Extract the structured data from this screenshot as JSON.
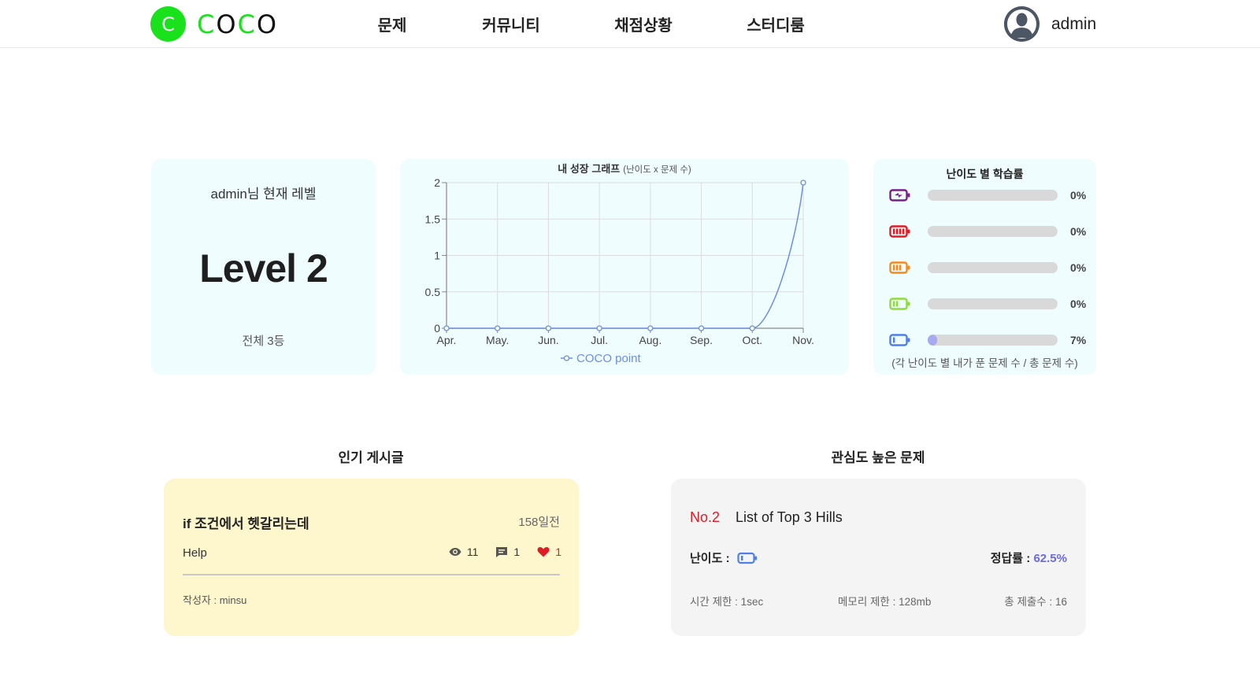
{
  "header": {
    "logo_letter": "C",
    "logo_text": [
      "C",
      "O",
      "C",
      "O"
    ],
    "nav": [
      "문제",
      "커뮤니티",
      "채점상황",
      "스터디룸"
    ],
    "user_name": "admin"
  },
  "level_card": {
    "title": "admin님 현재 레벨",
    "level": "Level 2",
    "rank": "전체 3등"
  },
  "chart_data": {
    "type": "line",
    "title": "내 성장 그래프",
    "subtitle": "(난이도 x 문제 수)",
    "x": [
      "Apr.",
      "May.",
      "Jun.",
      "Jul.",
      "Aug.",
      "Sep.",
      "Oct.",
      "Nov."
    ],
    "series": [
      {
        "name": "COCO point",
        "values": [
          0,
          0,
          0,
          0,
          0,
          0,
          0,
          2
        ],
        "color": "#6c8fe0"
      }
    ],
    "yticks": [
      "0",
      "0.5",
      "1",
      "1.5",
      "2"
    ],
    "ylim": [
      0,
      2
    ],
    "grid": true,
    "legend": "bottom"
  },
  "difficulty": {
    "title": "난이도 별 학습률",
    "levels": [
      {
        "icon": "battery-charging-icon",
        "color": "#7b1f8a",
        "percent": "0%",
        "fill": 0
      },
      {
        "icon": "battery-full-icon",
        "color": "#e01b24",
        "percent": "0%",
        "fill": 0
      },
      {
        "icon": "battery-three-quarter-icon",
        "color": "#f48a1c",
        "percent": "0%",
        "fill": 0
      },
      {
        "icon": "battery-half-icon",
        "color": "#8ddc3a",
        "percent": "0%",
        "fill": 0
      },
      {
        "icon": "battery-low-icon",
        "color": "#4f7ee8",
        "percent": "7%",
        "fill": 7
      }
    ],
    "fill_color": "#a9a9f2",
    "note": "(각 난이도 별 내가 푼 문제 수 / 총 문제 수)"
  },
  "popular": {
    "heading": "인기 게시글",
    "post": {
      "title": "if 조건에서 헷갈리는데",
      "date": "158일전",
      "category": "Help",
      "views": "11",
      "comments": "1",
      "likes": "1",
      "author": "작성자 : minsu"
    }
  },
  "interest": {
    "heading": "관심도 높은 문제",
    "problem": {
      "number": "No.2",
      "name": "List of Top 3 Hills",
      "difficulty_label": "난이도 :",
      "difficulty_icon": "battery-low-icon",
      "rate_label": "정답률 :",
      "rate": "62.5%",
      "time_limit": "시간 제한 : 1sec",
      "memory_limit": "메모리 제한 : 128mb",
      "submissions": "총 제출수 : 16"
    }
  }
}
